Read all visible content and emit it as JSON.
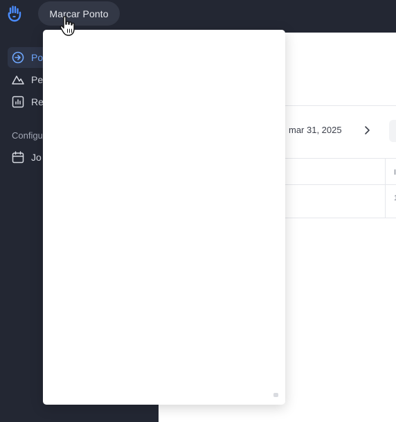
{
  "topbar": {
    "logo_icon": "hand-logo-icon",
    "clock_in_button": "Marcar Ponto",
    "cursor_icon": "hand-pointer-cursor-icon"
  },
  "sidebar": {
    "items": [
      {
        "label": "Po",
        "icon": "arrow-right-circle-icon",
        "active": true
      },
      {
        "label": "Pe",
        "icon": "mountain-icon",
        "active": false
      },
      {
        "label": "Re",
        "icon": "bar-chart-icon",
        "active": false
      }
    ],
    "section_label": "Configu",
    "section_items": [
      {
        "label": "Jo",
        "icon": "calendar-icon"
      }
    ]
  },
  "main": {
    "date_range": "mar 31, 2025",
    "next_icon": "chevron-right-icon",
    "table_header_fragment": "I",
    "table_cell_fragment": "1"
  },
  "colors": {
    "sidebar_bg": "#232733",
    "accent": "#6fa8ff",
    "button_bg": "#333846"
  }
}
